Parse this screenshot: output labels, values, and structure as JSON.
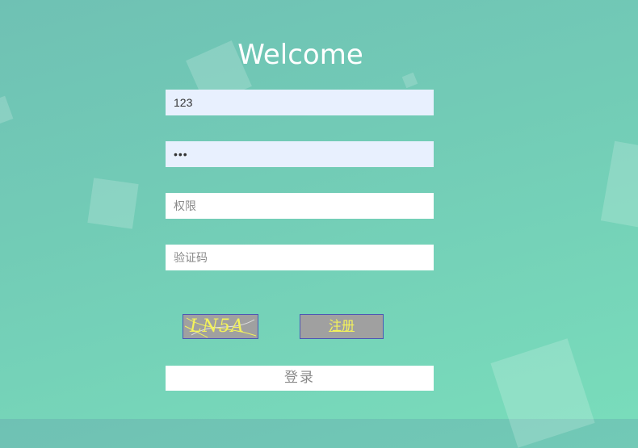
{
  "login": {
    "title": "Welcome",
    "username": {
      "value": "123",
      "placeholder": ""
    },
    "password": {
      "value": "123",
      "placeholder": ""
    },
    "permission": {
      "value": "",
      "placeholder": "权限"
    },
    "verification_code": {
      "value": "",
      "placeholder": "验证码"
    },
    "captcha_text": "LN5A",
    "register_label": "注册",
    "login_label": "登录"
  },
  "colors": {
    "background_top": "#6fc1b4",
    "background_bottom": "#79dcbb",
    "captcha_text": "#f4f35a",
    "button_border": "#4a57b5"
  }
}
